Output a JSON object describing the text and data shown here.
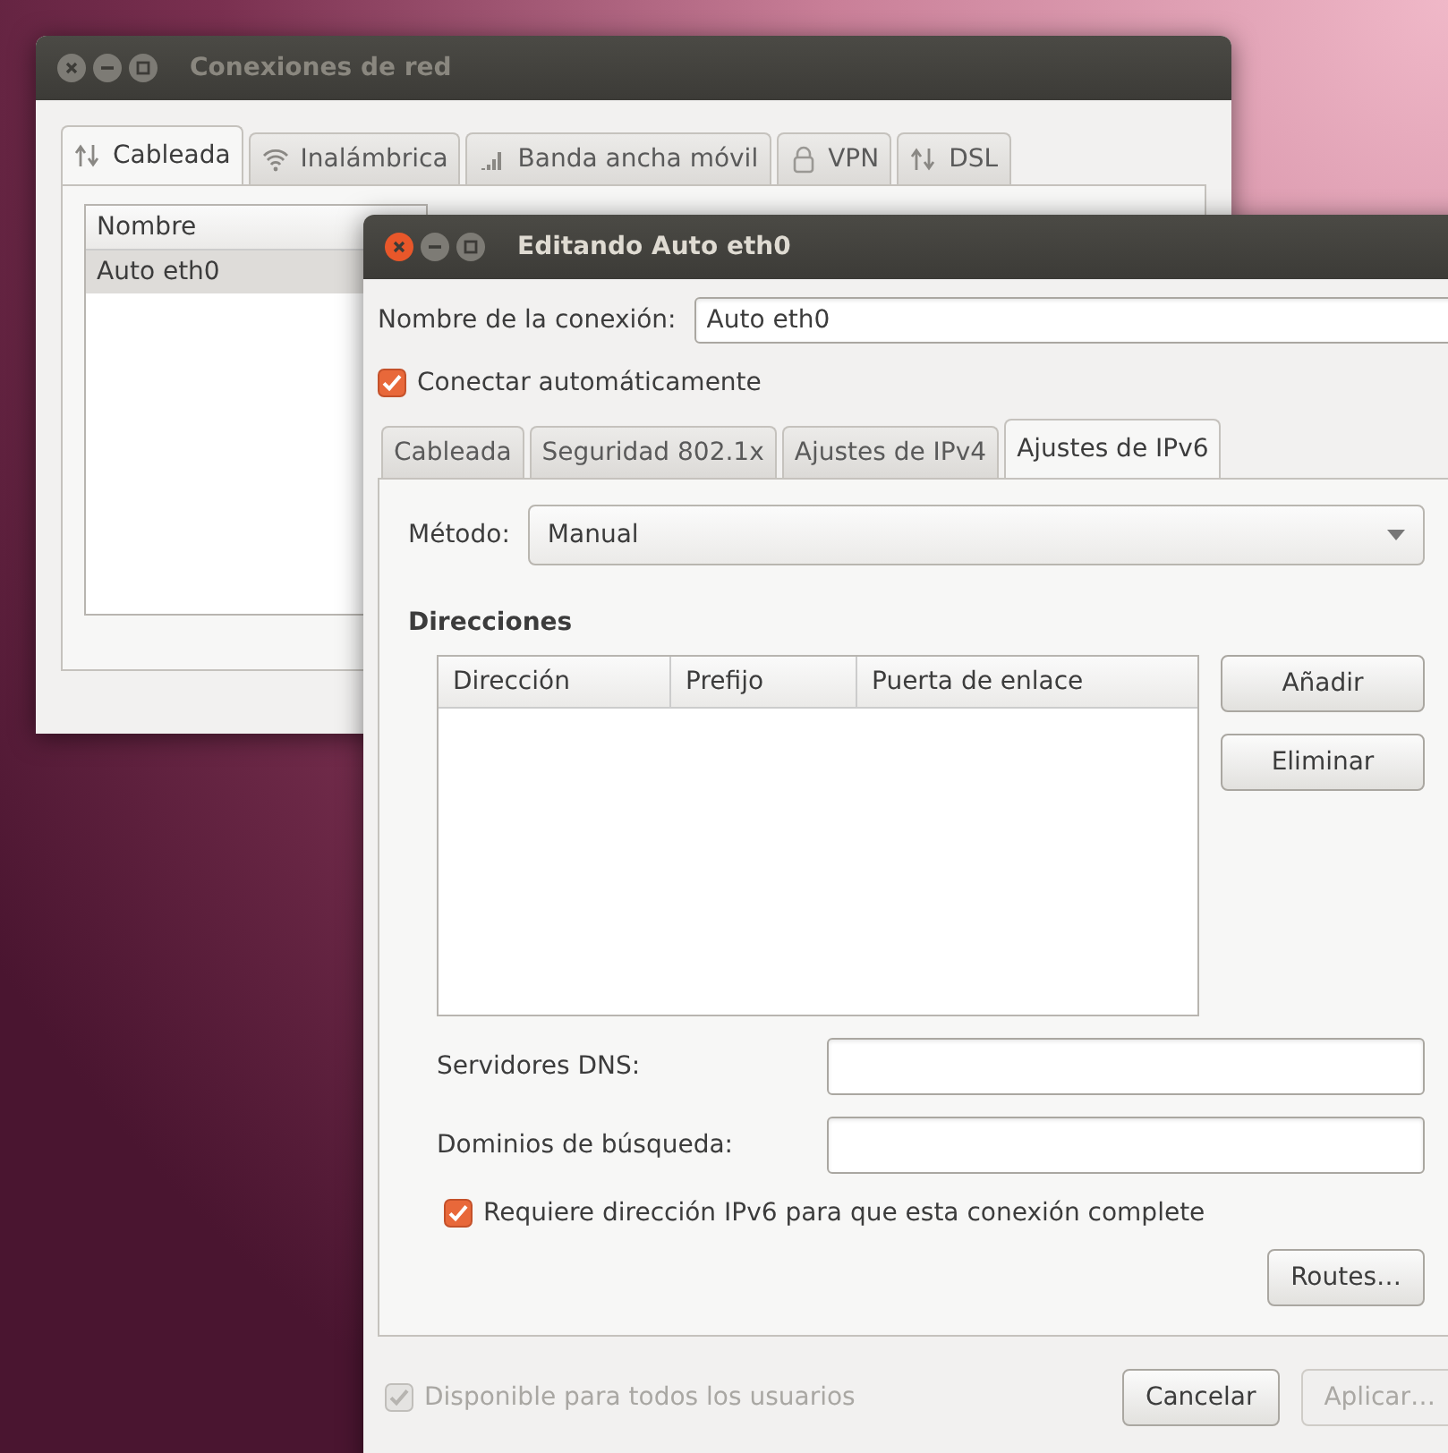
{
  "back_window": {
    "title": "Conexiones de red",
    "active": false,
    "tabs": [
      {
        "label": "Cableada",
        "kind": "wired",
        "selected": true
      },
      {
        "label": "Inalámbrica",
        "kind": "wireless",
        "selected": false
      },
      {
        "label": "Banda ancha móvil",
        "kind": "mobile",
        "selected": false
      },
      {
        "label": "VPN",
        "kind": "vpn",
        "selected": false
      },
      {
        "label": "DSL",
        "kind": "dsl",
        "selected": false
      }
    ],
    "list": {
      "columns": [
        "Nombre"
      ],
      "rows": [
        {
          "name": "Auto eth0",
          "selected": true
        }
      ]
    }
  },
  "edit_window": {
    "title": "Editando Auto eth0",
    "active": true,
    "connection_name_label": "Nombre de la conexión:",
    "connection_name": "Auto eth0",
    "autoconnect": {
      "label": "Conectar automáticamente",
      "checked": true
    },
    "tabs": [
      {
        "label": "Cableada",
        "selected": false
      },
      {
        "label": "Seguridad 802.1x",
        "selected": false
      },
      {
        "label": "Ajustes de IPv4",
        "selected": false
      },
      {
        "label": "Ajustes de IPv6",
        "selected": true
      }
    ],
    "method_label": "Método:",
    "method": "Manual",
    "addresses_heading": "Direcciones",
    "addresses_columns": [
      "Dirección",
      "Prefijo",
      "Puerta de enlace"
    ],
    "address_buttons": [
      "Añadir",
      "Eliminar"
    ],
    "dns_label": "Servidores DNS:",
    "search_domains_label": "Dominios de búsqueda:",
    "require_ipv6": {
      "label": "Requiere dirección IPv6 para que esta conexión complete",
      "checked": true
    },
    "routes_button": "Routes…",
    "available_all": {
      "label": "Disponible para todos los usuarios",
      "checked": true,
      "disabled": true
    },
    "cancel_button": {
      "label": "Cancelar",
      "disabled": false
    },
    "apply_button": {
      "label": "Aplicar…",
      "disabled": true
    }
  }
}
